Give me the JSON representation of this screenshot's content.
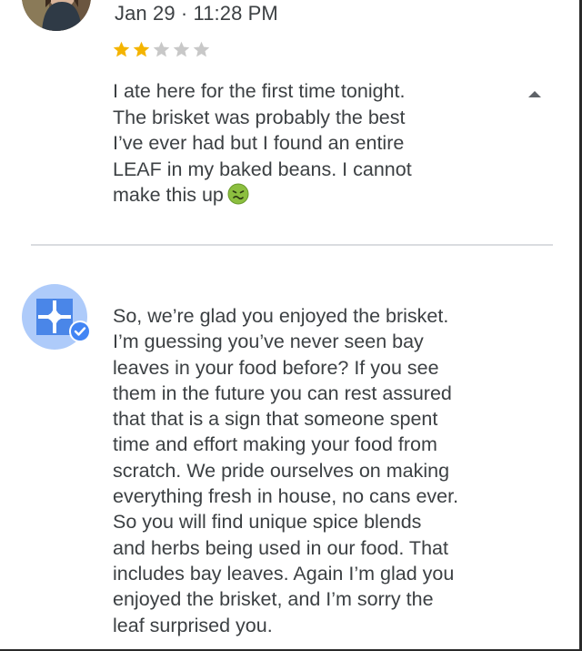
{
  "review": {
    "date": "Jan 29 · 11:28 PM",
    "rating": 2,
    "max_rating": 5,
    "text": "I ate here for the first time tonight.\nThe brisket was probably the best\nI’ve ever had but I found an entire\nLEAF in my baked beans. I cannot\nmake this up",
    "emoji": "nauseated-face",
    "star_color_filled": "#f4b400",
    "star_color_empty": "#c8c8c8"
  },
  "owner_reply": {
    "text": "So, we’re glad you enjoyed the brisket.\nI’m guessing you’ve never seen bay\nleaves in your food before? If you see\nthem in the future you can rest assured\nthat that is a sign that someone spent\ntime and effort making your food from\nscratch. We pride ourselves on making\neverything fresh in house, no cans ever.\nSo you will find unique spice blends\nand herbs being used in our food. That\nincludes bay leaves. Again I’m glad you\nenjoyed the brisket, and I’m sorry the\nleaf surprised you.",
    "avatar_color": "#aecbfa",
    "logo_color": "#4a86e8",
    "verified_badge_color": "#4285f4"
  }
}
